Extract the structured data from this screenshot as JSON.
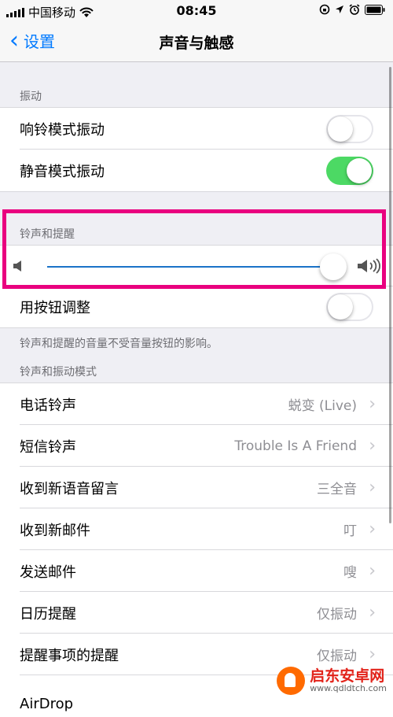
{
  "status_bar": {
    "carrier": "中国移动",
    "time": "08:45",
    "icons": [
      "signal-icon",
      "wifi-icon",
      "rotation-lock-icon",
      "location-icon",
      "alarm-icon",
      "battery-icon"
    ]
  },
  "nav": {
    "back_label": "设置",
    "title": "声音与触感"
  },
  "vibrate": {
    "header": "振动",
    "ring_label": "响铃模式振动",
    "ring_on": false,
    "silent_label": "静音模式振动",
    "silent_on": true
  },
  "ringer": {
    "header": "铃声和提醒",
    "volume_level": 0.9,
    "change_with_buttons_label": "用按钮调整",
    "change_with_buttons_on": false,
    "note": "铃声和提醒的音量不受音量按钮的影响。"
  },
  "patterns": {
    "header": "铃声和振动模式",
    "rows": [
      {
        "label": "电话铃声",
        "value": "蜕变 (Live)"
      },
      {
        "label": "短信铃声",
        "value": "Trouble Is A Friend"
      },
      {
        "label": "收到新语音留言",
        "value": "三全音"
      },
      {
        "label": "收到新邮件",
        "value": "叮"
      },
      {
        "label": "发送邮件",
        "value": "嗖"
      },
      {
        "label": "日历提醒",
        "value": "仅振动"
      },
      {
        "label": "提醒事项的提醒",
        "value": "仅振动"
      },
      {
        "label": "AirDrop",
        "value": ""
      }
    ]
  },
  "watermark": {
    "title": "启东安卓网",
    "url": "www.qdldtch.com"
  },
  "colors": {
    "accent": "#007aff",
    "switch_on": "#4cd964",
    "highlight": "#e9007f"
  }
}
